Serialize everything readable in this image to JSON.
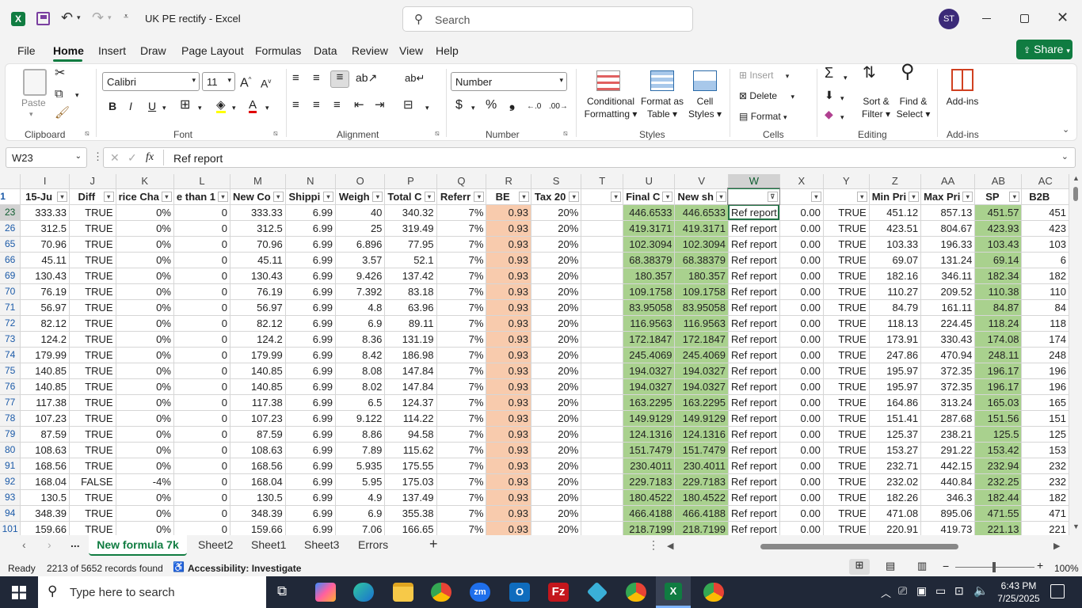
{
  "title": {
    "doc": "UK PE rectify",
    "sep": "-",
    "app": "Excel",
    "search_placeholder": "Search",
    "avatar": "ST"
  },
  "menu": {
    "file": "File",
    "home": "Home",
    "insert": "Insert",
    "draw": "Draw",
    "page_layout": "Page Layout",
    "formulas": "Formulas",
    "data": "Data",
    "review": "Review",
    "view": "View",
    "help": "Help",
    "share": "Share"
  },
  "ribbon": {
    "paste": "Paste",
    "clipboard": "Clipboard",
    "font_name": "Calibri",
    "font_size": "11",
    "font": "Font",
    "alignment": "Alignment",
    "number_format": "Number",
    "number": "Number",
    "cond1": "Conditional",
    "cond2": "Formatting",
    "fmt1": "Format as",
    "fmt2": "Table",
    "cell1": "Cell",
    "cell2": "Styles",
    "styles": "Styles",
    "insert": "Insert",
    "delete": "Delete",
    "format": "Format",
    "cells": "Cells",
    "sort1": "Sort &",
    "sort2": "Filter",
    "find1": "Find &",
    "find2": "Select",
    "editing": "Editing",
    "addins": "Add-ins",
    "addins_group": "Add-ins"
  },
  "formula_bar": {
    "name_box": "W23",
    "fx": "fx",
    "content": "Ref report"
  },
  "grid": {
    "columns": [
      "I",
      "J",
      "K",
      "L",
      "M",
      "N",
      "O",
      "P",
      "Q",
      "R",
      "S",
      "T",
      "U",
      "V",
      "W",
      "X",
      "Y",
      "Z",
      "AA",
      "AB",
      "AC"
    ],
    "header_row_num": "1",
    "headers": [
      "15-Ju",
      "Diff",
      "rice Cha",
      "e than 1",
      "New Co",
      "Shippi",
      "Weigh",
      "Total C",
      "Referr",
      "BE",
      "Tax 20",
      "",
      "Final C",
      "New sh",
      "",
      "",
      "",
      "Min Pri",
      "Max Pri",
      "SP",
      "B2B"
    ],
    "rows": [
      {
        "n": "23",
        "v": [
          "333.33",
          "TRUE",
          "0%",
          "0",
          "333.33",
          "6.99",
          "40",
          "340.32",
          "7%",
          "0.93",
          "20%",
          "",
          "446.6533",
          "446.6533",
          "Ref report",
          "0.00",
          "TRUE",
          "451.12",
          "857.13",
          "451.57",
          "451"
        ]
      },
      {
        "n": "26",
        "v": [
          "312.5",
          "TRUE",
          "0%",
          "0",
          "312.5",
          "6.99",
          "25",
          "319.49",
          "7%",
          "0.93",
          "20%",
          "",
          "419.3171",
          "419.3171",
          "Ref report",
          "0.00",
          "TRUE",
          "423.51",
          "804.67",
          "423.93",
          "423"
        ]
      },
      {
        "n": "65",
        "v": [
          "70.96",
          "TRUE",
          "0%",
          "0",
          "70.96",
          "6.99",
          "6.896",
          "77.95",
          "7%",
          "0.93",
          "20%",
          "",
          "102.3094",
          "102.3094",
          "Ref report",
          "0.00",
          "TRUE",
          "103.33",
          "196.33",
          "103.43",
          "103"
        ]
      },
      {
        "n": "66",
        "v": [
          "45.11",
          "TRUE",
          "0%",
          "0",
          "45.11",
          "6.99",
          "3.57",
          "52.1",
          "7%",
          "0.93",
          "20%",
          "",
          "68.38379",
          "68.38379",
          "Ref report",
          "0.00",
          "TRUE",
          "69.07",
          "131.24",
          "69.14",
          "6"
        ]
      },
      {
        "n": "69",
        "v": [
          "130.43",
          "TRUE",
          "0%",
          "0",
          "130.43",
          "6.99",
          "9.426",
          "137.42",
          "7%",
          "0.93",
          "20%",
          "",
          "180.357",
          "180.357",
          "Ref report",
          "0.00",
          "TRUE",
          "182.16",
          "346.11",
          "182.34",
          "182"
        ]
      },
      {
        "n": "70",
        "v": [
          "76.19",
          "TRUE",
          "0%",
          "0",
          "76.19",
          "6.99",
          "7.392",
          "83.18",
          "7%",
          "0.93",
          "20%",
          "",
          "109.1758",
          "109.1758",
          "Ref report",
          "0.00",
          "TRUE",
          "110.27",
          "209.52",
          "110.38",
          "110"
        ]
      },
      {
        "n": "71",
        "v": [
          "56.97",
          "TRUE",
          "0%",
          "0",
          "56.97",
          "6.99",
          "4.8",
          "63.96",
          "7%",
          "0.93",
          "20%",
          "",
          "83.95058",
          "83.95058",
          "Ref report",
          "0.00",
          "TRUE",
          "84.79",
          "161.11",
          "84.87",
          "84"
        ]
      },
      {
        "n": "72",
        "v": [
          "82.12",
          "TRUE",
          "0%",
          "0",
          "82.12",
          "6.99",
          "6.9",
          "89.11",
          "7%",
          "0.93",
          "20%",
          "",
          "116.9563",
          "116.9563",
          "Ref report",
          "0.00",
          "TRUE",
          "118.13",
          "224.45",
          "118.24",
          "118"
        ]
      },
      {
        "n": "73",
        "v": [
          "124.2",
          "TRUE",
          "0%",
          "0",
          "124.2",
          "6.99",
          "8.36",
          "131.19",
          "7%",
          "0.93",
          "20%",
          "",
          "172.1847",
          "172.1847",
          "Ref report",
          "0.00",
          "TRUE",
          "173.91",
          "330.43",
          "174.08",
          "174"
        ]
      },
      {
        "n": "74",
        "v": [
          "179.99",
          "TRUE",
          "0%",
          "0",
          "179.99",
          "6.99",
          "8.42",
          "186.98",
          "7%",
          "0.93",
          "20%",
          "",
          "245.4069",
          "245.4069",
          "Ref report",
          "0.00",
          "TRUE",
          "247.86",
          "470.94",
          "248.11",
          "248"
        ]
      },
      {
        "n": "75",
        "v": [
          "140.85",
          "TRUE",
          "0%",
          "0",
          "140.85",
          "6.99",
          "8.08",
          "147.84",
          "7%",
          "0.93",
          "20%",
          "",
          "194.0327",
          "194.0327",
          "Ref report",
          "0.00",
          "TRUE",
          "195.97",
          "372.35",
          "196.17",
          "196"
        ]
      },
      {
        "n": "76",
        "v": [
          "140.85",
          "TRUE",
          "0%",
          "0",
          "140.85",
          "6.99",
          "8.02",
          "147.84",
          "7%",
          "0.93",
          "20%",
          "",
          "194.0327",
          "194.0327",
          "Ref report",
          "0.00",
          "TRUE",
          "195.97",
          "372.35",
          "196.17",
          "196"
        ]
      },
      {
        "n": "77",
        "v": [
          "117.38",
          "TRUE",
          "0%",
          "0",
          "117.38",
          "6.99",
          "6.5",
          "124.37",
          "7%",
          "0.93",
          "20%",
          "",
          "163.2295",
          "163.2295",
          "Ref report",
          "0.00",
          "TRUE",
          "164.86",
          "313.24",
          "165.03",
          "165"
        ]
      },
      {
        "n": "78",
        "v": [
          "107.23",
          "TRUE",
          "0%",
          "0",
          "107.23",
          "6.99",
          "9.122",
          "114.22",
          "7%",
          "0.93",
          "20%",
          "",
          "149.9129",
          "149.9129",
          "Ref report",
          "0.00",
          "TRUE",
          "151.41",
          "287.68",
          "151.56",
          "151"
        ]
      },
      {
        "n": "79",
        "v": [
          "87.59",
          "TRUE",
          "0%",
          "0",
          "87.59",
          "6.99",
          "8.86",
          "94.58",
          "7%",
          "0.93",
          "20%",
          "",
          "124.1316",
          "124.1316",
          "Ref report",
          "0.00",
          "TRUE",
          "125.37",
          "238.21",
          "125.5",
          "125"
        ]
      },
      {
        "n": "80",
        "v": [
          "108.63",
          "TRUE",
          "0%",
          "0",
          "108.63",
          "6.99",
          "7.89",
          "115.62",
          "7%",
          "0.93",
          "20%",
          "",
          "151.7479",
          "151.7479",
          "Ref report",
          "0.00",
          "TRUE",
          "153.27",
          "291.22",
          "153.42",
          "153"
        ]
      },
      {
        "n": "91",
        "v": [
          "168.56",
          "TRUE",
          "0%",
          "0",
          "168.56",
          "6.99",
          "5.935",
          "175.55",
          "7%",
          "0.93",
          "20%",
          "",
          "230.4011",
          "230.4011",
          "Ref report",
          "0.00",
          "TRUE",
          "232.71",
          "442.15",
          "232.94",
          "232"
        ]
      },
      {
        "n": "92",
        "v": [
          "168.04",
          "FALSE",
          "-4%",
          "0",
          "168.04",
          "6.99",
          "5.95",
          "175.03",
          "7%",
          "0.93",
          "20%",
          "",
          "229.7183",
          "229.7183",
          "Ref report",
          "0.00",
          "TRUE",
          "232.02",
          "440.84",
          "232.25",
          "232"
        ]
      },
      {
        "n": "93",
        "v": [
          "130.5",
          "TRUE",
          "0%",
          "0",
          "130.5",
          "6.99",
          "4.9",
          "137.49",
          "7%",
          "0.93",
          "20%",
          "",
          "180.4522",
          "180.4522",
          "Ref report",
          "0.00",
          "TRUE",
          "182.26",
          "346.3",
          "182.44",
          "182"
        ]
      },
      {
        "n": "94",
        "v": [
          "348.39",
          "TRUE",
          "0%",
          "0",
          "348.39",
          "6.99",
          "6.9",
          "355.38",
          "7%",
          "0.93",
          "20%",
          "",
          "466.4188",
          "466.4188",
          "Ref report",
          "0.00",
          "TRUE",
          "471.08",
          "895.06",
          "471.55",
          "471"
        ]
      },
      {
        "n": "101",
        "v": [
          "159.66",
          "TRUE",
          "0%",
          "0",
          "159.66",
          "6.99",
          "7.06",
          "166.65",
          "7%",
          "0.93",
          "20%",
          "",
          "218.7199",
          "218.7199",
          "Ref report",
          "0.00",
          "TRUE",
          "220.91",
          "419.73",
          "221.13",
          "221"
        ]
      }
    ]
  },
  "sheets": {
    "more": "...",
    "active": "New formula 7k",
    "s2": "Sheet2",
    "s1": "Sheet1",
    "s3": "Sheet3",
    "errors": "Errors",
    "add": "+"
  },
  "status": {
    "ready": "Ready",
    "records": "2213 of 5652 records found",
    "accessibility": "Accessibility: Investigate",
    "zoom": "100%"
  },
  "taskbar": {
    "search": "Type here to search",
    "time": "6:43 PM",
    "date": "7/25/2025"
  }
}
